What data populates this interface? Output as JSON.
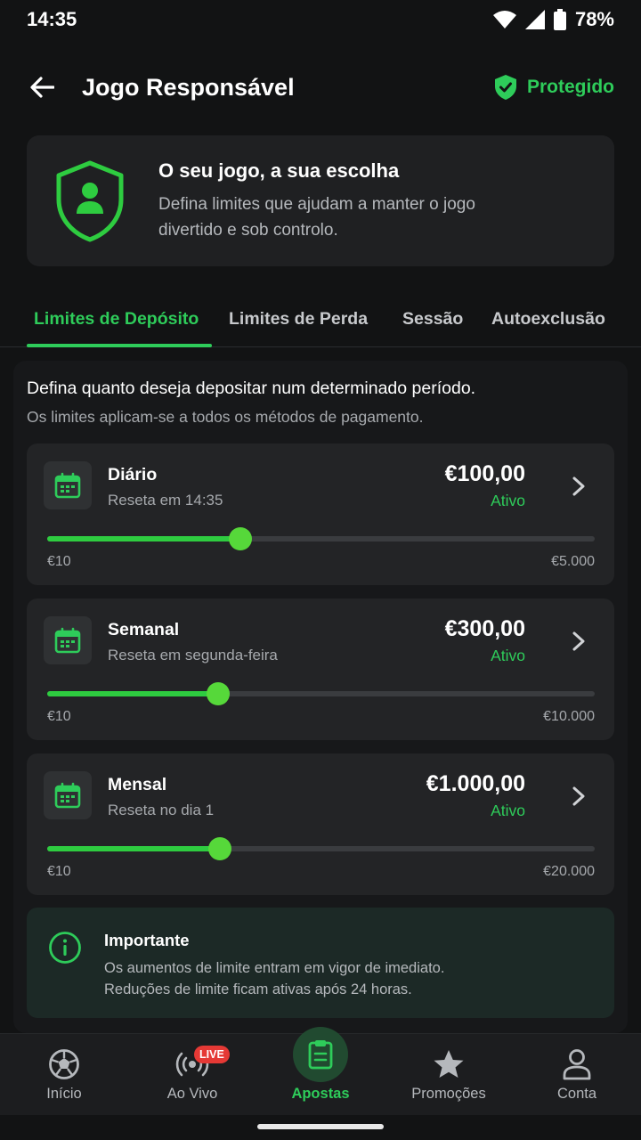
{
  "status_bar": {
    "time": "14:35",
    "battery": "78%"
  },
  "app_bar": {
    "title": "Jogo Responsável",
    "protected_label": "Protegido"
  },
  "hero": {
    "title": "O seu jogo, a sua escolha",
    "description": "Defina limites que ajudam a manter o jogo divertido e sob controlo."
  },
  "tabs": [
    {
      "label": "Limites de Depósito",
      "active": true
    },
    {
      "label": "Limites de Perda",
      "active": false
    },
    {
      "label": "Sessão",
      "active": false
    },
    {
      "label": "Autoexclusão",
      "active": false
    }
  ],
  "intro": {
    "title": "Defina quanto deseja depositar num determinado período.",
    "subtitle": "Os limites aplicam-se a todos os métodos de pagamento."
  },
  "limits": [
    {
      "name": "Diário",
      "reset": "Reseta em 14:35",
      "amount": "€100,00",
      "status": "Ativo",
      "min": "€10",
      "max": "€5.000",
      "fill_fraction": 0.353
    },
    {
      "name": "Semanal",
      "reset": "Reseta em segunda-feira",
      "amount": "€300,00",
      "status": "Ativo",
      "min": "€10",
      "max": "€10.000",
      "fill_fraction": 0.313
    },
    {
      "name": "Mensal",
      "reset": "Reseta no dia 1",
      "amount": "€1.000,00",
      "status": "Ativo",
      "min": "€10",
      "max": "€20.000",
      "fill_fraction": 0.316
    }
  ],
  "info": {
    "title": "Importante",
    "line1": "Os aumentos de limite entram em vigor de imediato.",
    "line2": "Reduções de limite ficam ativas após 24 horas."
  },
  "bottom_nav": [
    {
      "label": "Início",
      "icon": "soccer-ball-icon"
    },
    {
      "label": "Ao Vivo",
      "icon": "live-broadcast-icon",
      "badge": "LIVE"
    },
    {
      "label": "Apostas",
      "icon": "bet-slip-icon",
      "active": true
    },
    {
      "label": "Promoções",
      "icon": "star-icon"
    },
    {
      "label": "Conta",
      "icon": "user-icon"
    }
  ],
  "colors": {
    "accent": "#2ecc5a",
    "live_badge": "#e53935",
    "background": "#121314"
  }
}
